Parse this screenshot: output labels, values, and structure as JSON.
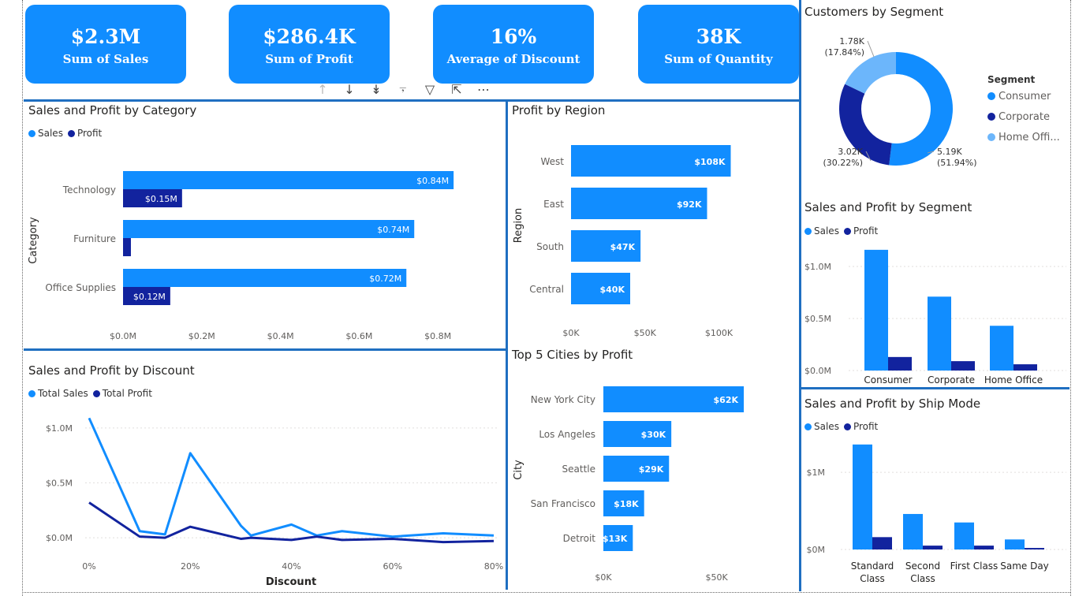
{
  "kpis": [
    {
      "value": "$2.3M",
      "label": "Sum of Sales"
    },
    {
      "value": "$286.4K",
      "label": "Sum of Profit"
    },
    {
      "value": "16%",
      "label": "Average of Discount"
    },
    {
      "value": "38K",
      "label": "Sum of Quantity"
    }
  ],
  "colors": {
    "sales": "#118dff",
    "profit": "#12239e",
    "home_office": "#6cb6fb",
    "divider": "#1f6fc1"
  },
  "toolbar_icons": [
    "arrow-up-icon",
    "arrow-down-icon",
    "double-arrow-down-icon",
    "expand-hierarchy-icon",
    "filter-icon",
    "focus-mode-icon",
    "more-options-icon"
  ],
  "chart_data": [
    {
      "id": "category",
      "type": "bar",
      "orientation": "horizontal",
      "title": "Sales and Profit by Category",
      "ylabel": "Category",
      "categories": [
        "Technology",
        "Furniture",
        "Office Supplies"
      ],
      "series": [
        {
          "name": "Sales",
          "values": [
            0.84,
            0.74,
            0.72
          ],
          "labels": [
            "$0.84M",
            "$0.74M",
            "$0.72M"
          ]
        },
        {
          "name": "Profit",
          "values": [
            0.15,
            0.02,
            0.12
          ],
          "labels": [
            "$0.15M",
            "",
            "$0.12M"
          ]
        }
      ],
      "xlim": [
        0,
        0.95
      ],
      "xticks": [
        0,
        0.2,
        0.4,
        0.6,
        0.8
      ],
      "xtick_labels": [
        "$0.0M",
        "$0.2M",
        "$0.4M",
        "$0.6M",
        "$0.8M"
      ],
      "legend": "top-left"
    },
    {
      "id": "region",
      "type": "bar",
      "orientation": "horizontal",
      "title": "Profit by Region",
      "ylabel": "Region",
      "categories": [
        "West",
        "East",
        "South",
        "Central"
      ],
      "values": [
        108,
        92,
        47,
        40
      ],
      "labels": [
        "$108K",
        "$92K",
        "$47K",
        "$40K"
      ],
      "xlim": [
        0,
        120
      ],
      "xticks": [
        0,
        50,
        100
      ],
      "xtick_labels": [
        "$0K",
        "$50K",
        "$100K"
      ]
    },
    {
      "id": "cities",
      "type": "bar",
      "orientation": "horizontal",
      "title": "Top 5 Cities by Profit",
      "ylabel": "City",
      "categories": [
        "New York City",
        "Los Angeles",
        "Seattle",
        "San Francisco",
        "Detroit"
      ],
      "values": [
        62,
        30,
        29,
        18,
        13
      ],
      "labels": [
        "$62K",
        "$30K",
        "$29K",
        "$18K",
        "$13K"
      ],
      "xlim": [
        0,
        70
      ],
      "xticks": [
        0,
        50
      ],
      "xtick_labels": [
        "$0K",
        "$50K"
      ]
    },
    {
      "id": "discount",
      "type": "line",
      "title": "Sales and Profit by Discount",
      "xlabel": "Discount",
      "x": [
        0,
        10,
        15,
        20,
        30,
        32,
        40,
        45,
        50,
        60,
        70,
        80
      ],
      "series": [
        {
          "name": "Total Sales",
          "values": [
            1.09,
            0.06,
            0.03,
            0.77,
            0.11,
            0.02,
            0.12,
            0.02,
            0.06,
            0.01,
            0.04,
            0.02
          ]
        },
        {
          "name": "Total Profit",
          "values": [
            0.32,
            0.01,
            0.0,
            0.1,
            -0.01,
            0.0,
            -0.02,
            0.01,
            -0.02,
            -0.01,
            -0.04,
            -0.03
          ]
        }
      ],
      "xlim": [
        0,
        80
      ],
      "ylim": [
        -0.1,
        1.2
      ],
      "xticks": [
        0,
        20,
        40,
        60,
        80
      ],
      "xtick_labels": [
        "0%",
        "20%",
        "40%",
        "60%",
        "80%"
      ],
      "yticks": [
        0,
        0.5,
        1.0
      ],
      "ytick_labels": [
        "$0.0M",
        "$0.5M",
        "$1.0M"
      ]
    },
    {
      "id": "customers",
      "type": "pie",
      "donut": true,
      "title": "Customers by Segment",
      "legend_title": "Segment",
      "categories": [
        "Consumer",
        "Corporate",
        "Home Office"
      ],
      "legend_labels": [
        "Consumer",
        "Corporate",
        "Home Offi..."
      ],
      "values": [
        5.19,
        3.02,
        1.78
      ],
      "value_labels": [
        "5.19K",
        "3.02K",
        "1.78K"
      ],
      "percent_labels": [
        "(51.94%)",
        "(30.22%)",
        "(17.84%)"
      ]
    },
    {
      "id": "segment",
      "type": "bar",
      "title": "Sales and Profit by Segment",
      "categories": [
        "Consumer",
        "Corporate",
        "Home Office"
      ],
      "series": [
        {
          "name": "Sales",
          "values": [
            1.16,
            0.71,
            0.43
          ]
        },
        {
          "name": "Profit",
          "values": [
            0.13,
            0.09,
            0.06
          ]
        }
      ],
      "ylim": [
        0,
        1.25
      ],
      "yticks": [
        0,
        0.5,
        1.0
      ],
      "ytick_labels": [
        "$0.0M",
        "$0.5M",
        "$1.0M"
      ]
    },
    {
      "id": "shipmode",
      "type": "bar",
      "title": "Sales and Profit by Ship Mode",
      "categories": [
        "Standard Class",
        "Second Class",
        "First Class",
        "Same Day"
      ],
      "category_lines": [
        [
          "Standard",
          "Class"
        ],
        [
          "Second",
          "Class"
        ],
        [
          "First Class"
        ],
        [
          "Same Day"
        ]
      ],
      "series": [
        {
          "name": "Sales",
          "values": [
            1.36,
            0.46,
            0.35,
            0.13
          ]
        },
        {
          "name": "Profit",
          "values": [
            0.16,
            0.05,
            0.05,
            0.02
          ]
        }
      ],
      "ylim": [
        0,
        1.45
      ],
      "yticks": [
        0,
        1.0
      ],
      "ytick_labels": [
        "$0M",
        "$1M"
      ]
    }
  ]
}
